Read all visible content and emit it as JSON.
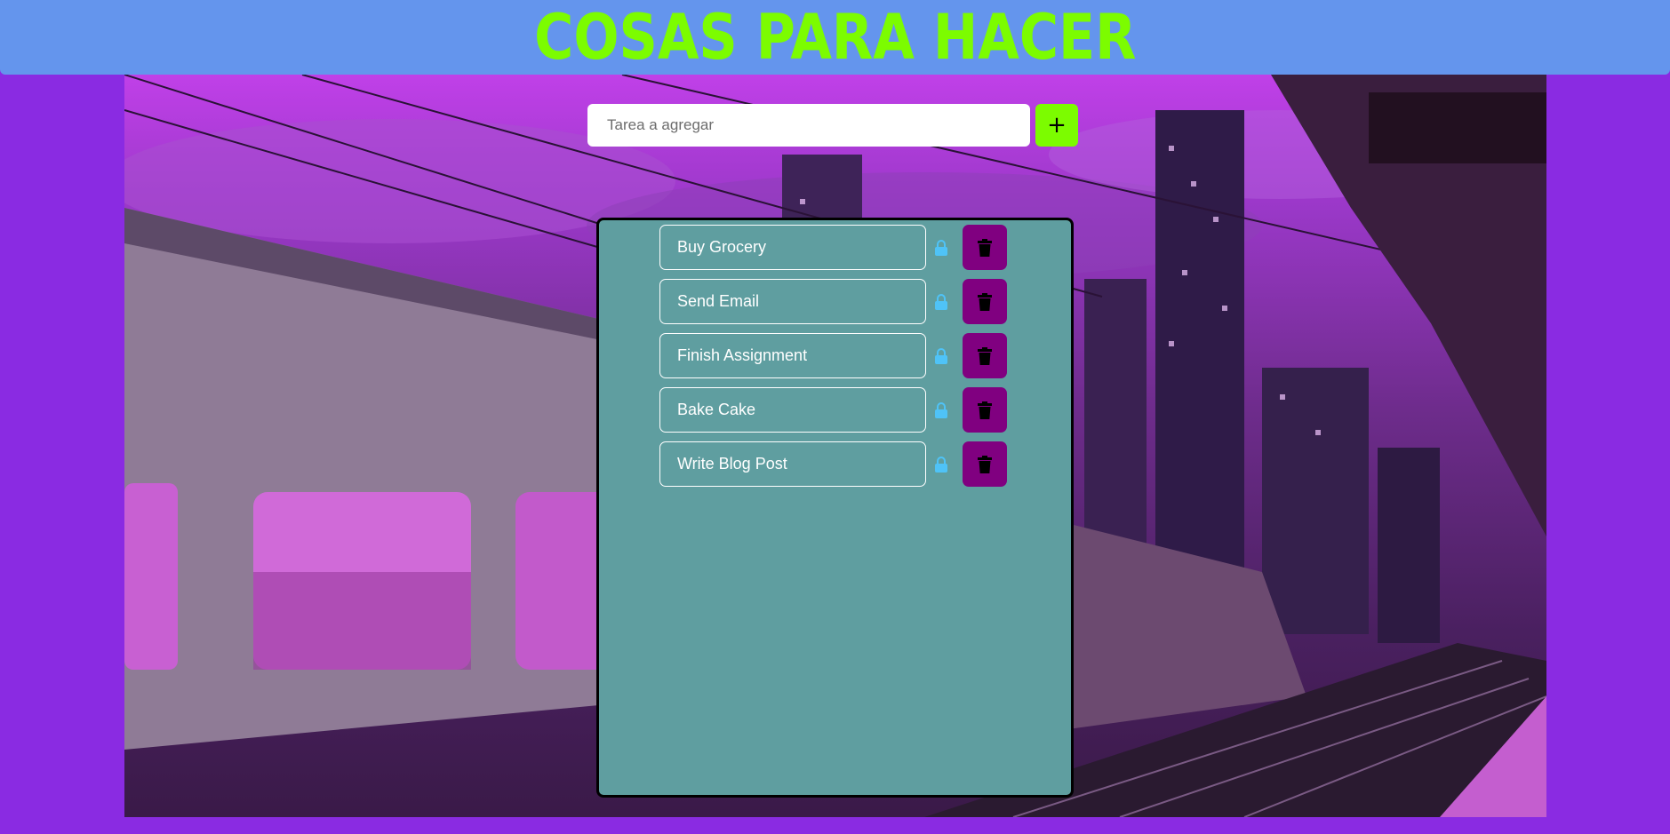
{
  "header": {
    "title": "COSAS PARA HACER"
  },
  "add_task": {
    "placeholder": "Tarea a agregar",
    "value": "",
    "button_label": "+"
  },
  "todos": [
    {
      "text": "Buy Grocery"
    },
    {
      "text": "Send Email"
    },
    {
      "text": "Finish Assignment"
    },
    {
      "text": "Bake Cake"
    },
    {
      "text": "Write Blog Post"
    }
  ],
  "icons": {
    "lock": "lock-icon",
    "delete": "trash-icon"
  },
  "colors": {
    "header_bg": "#6495ed",
    "title": "#7cfc00",
    "page_bg": "#8a2be2",
    "panel_bg": "#5f9ea0",
    "add_button": "#7cfc00",
    "delete_button": "#800080",
    "lock_icon": "#4fc3f7"
  }
}
